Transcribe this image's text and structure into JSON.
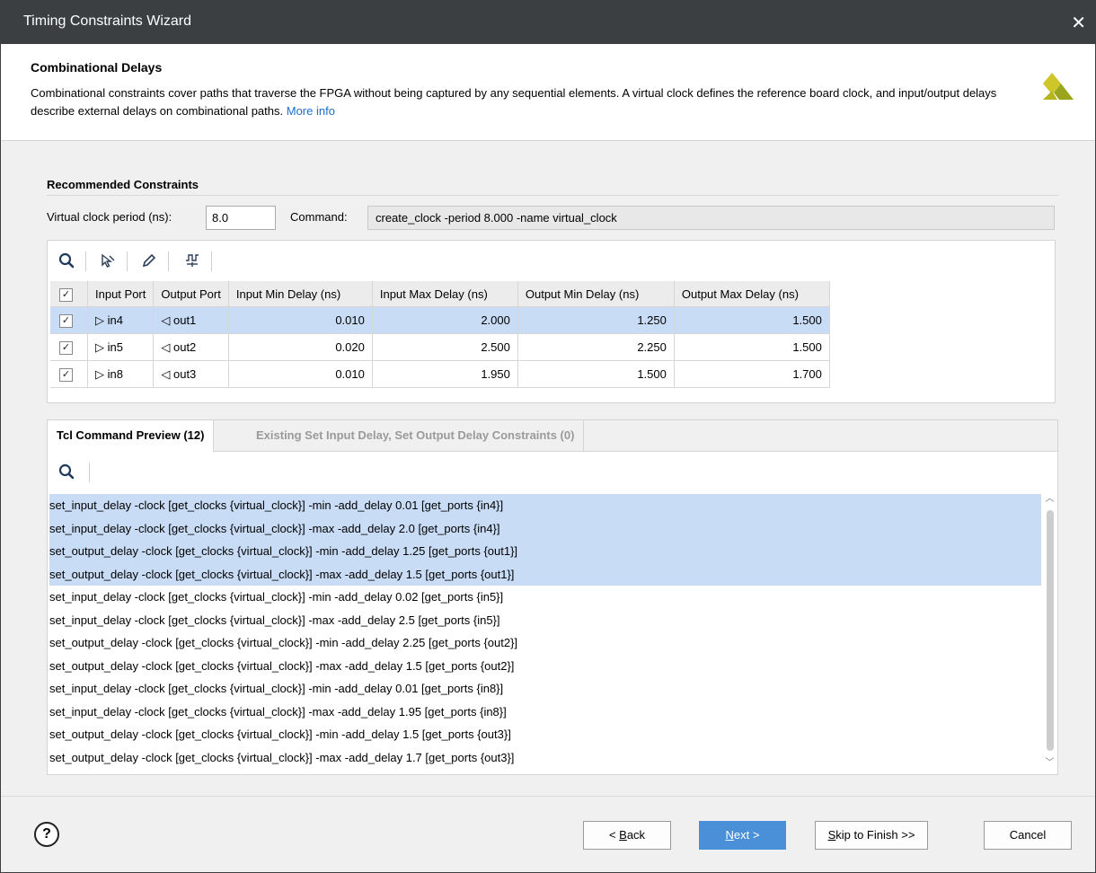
{
  "window": {
    "title": "Timing Constraints Wizard",
    "close_glyph": "✕"
  },
  "header": {
    "title": "Combinational Delays",
    "description": "Combinational constraints cover paths that traverse the FPGA without being captured by any sequential elements. A virtual clock defines the reference board clock, and input/output delays describe external delays on combinational paths.",
    "more_info": "More info"
  },
  "recommended": {
    "section_title": "Recommended Constraints",
    "vcp_label": "Virtual clock period (ns):",
    "vcp_value": "8.0",
    "command_label": "Command:",
    "command_value": "create_clock -period 8.000 -name virtual_clock"
  },
  "toolbar": {
    "icons": [
      "search-icon",
      "select-icon",
      "edit-icon",
      "waveform-icon"
    ]
  },
  "table": {
    "columns": [
      "Input Port",
      "Output Port",
      "Input Min Delay (ns)",
      "Input Max Delay (ns)",
      "Output Min Delay (ns)",
      "Output Max Delay (ns)"
    ],
    "rows": [
      {
        "checked": true,
        "in": "in4",
        "out": "out1",
        "in_min": "0.010",
        "in_max": "2.000",
        "out_min": "1.250",
        "out_max": "1.500",
        "selected": true
      },
      {
        "checked": true,
        "in": "in5",
        "out": "out2",
        "in_min": "0.020",
        "in_max": "2.500",
        "out_min": "2.250",
        "out_max": "1.500",
        "selected": false
      },
      {
        "checked": true,
        "in": "in8",
        "out": "out3",
        "in_min": "0.010",
        "in_max": "1.950",
        "out_min": "1.500",
        "out_max": "1.700",
        "selected": false
      }
    ]
  },
  "tabs": {
    "active": "Tcl Command Preview (12)",
    "inactive": "Existing Set Input Delay, Set Output Delay Constraints (0)"
  },
  "tcl_lines": [
    {
      "text": "set_input_delay -clock [get_clocks {virtual_clock}] -min -add_delay 0.01 [get_ports {in4}]",
      "selected": true
    },
    {
      "text": "set_input_delay -clock [get_clocks {virtual_clock}] -max -add_delay 2.0 [get_ports {in4}]",
      "selected": true
    },
    {
      "text": "set_output_delay -clock [get_clocks {virtual_clock}] -min -add_delay 1.25 [get_ports {out1}]",
      "selected": true
    },
    {
      "text": "set_output_delay -clock [get_clocks {virtual_clock}] -max -add_delay 1.5 [get_ports {out1}]",
      "selected": true
    },
    {
      "text": "set_input_delay -clock [get_clocks {virtual_clock}] -min -add_delay 0.02 [get_ports {in5}]",
      "selected": false
    },
    {
      "text": "set_input_delay -clock [get_clocks {virtual_clock}] -max -add_delay 2.5 [get_ports {in5}]",
      "selected": false
    },
    {
      "text": "set_output_delay -clock [get_clocks {virtual_clock}] -min -add_delay 2.25 [get_ports {out2}]",
      "selected": false
    },
    {
      "text": "set_output_delay -clock [get_clocks {virtual_clock}] -max -add_delay 1.5 [get_ports {out2}]",
      "selected": false
    },
    {
      "text": "set_input_delay -clock [get_clocks {virtual_clock}] -min -add_delay 0.01 [get_ports {in8}]",
      "selected": false
    },
    {
      "text": "set_input_delay -clock [get_clocks {virtual_clock}] -max -add_delay 1.95 [get_ports {in8}]",
      "selected": false
    },
    {
      "text": "set_output_delay -clock [get_clocks {virtual_clock}] -min -add_delay 1.5 [get_ports {out3}]",
      "selected": false
    },
    {
      "text": "set_output_delay -clock [get_clocks {virtual_clock}] -max -add_delay 1.7 [get_ports {out3}]",
      "selected": false
    }
  ],
  "footer": {
    "help": "?",
    "back_prefix": "< ",
    "back_mnemonic": "B",
    "back_rest": "ack",
    "next_mnemonic": "N",
    "next_rest": "ext >",
    "skip_mnemonic": "S",
    "skip_rest": "kip to Finish >>",
    "cancel": "Cancel"
  },
  "colors": {
    "accent": "#4a90d9",
    "selection": "#c9dcf6",
    "titlebar": "#3c3f41",
    "logo": "#c8c020"
  }
}
